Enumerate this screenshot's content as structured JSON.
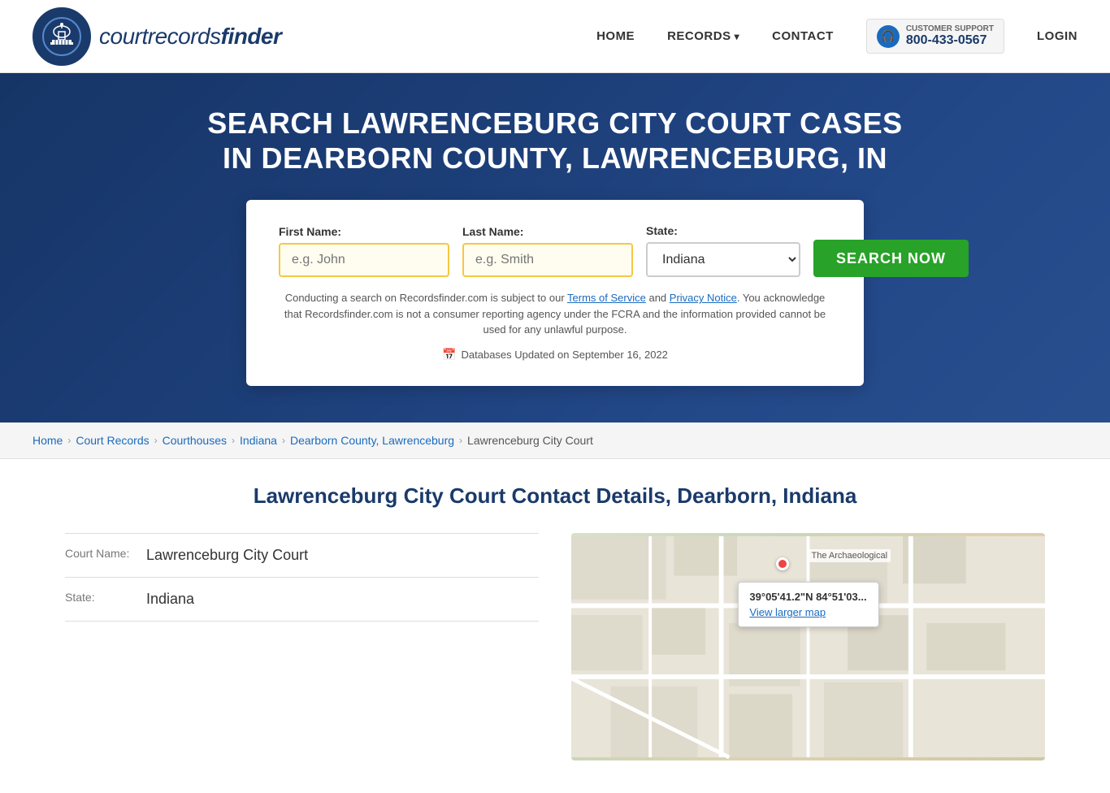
{
  "header": {
    "logo_text_italic": "courtrecords",
    "logo_text_bold": "finder",
    "nav": {
      "home": "HOME",
      "records": "RECORDS",
      "contact": "CONTACT",
      "login": "LOGIN"
    },
    "support": {
      "label": "CUSTOMER SUPPORT",
      "phone": "800-433-0567"
    }
  },
  "hero": {
    "title": "SEARCH LAWRENCEBURG CITY COURT CASES IN DEARBORN COUNTY, LAWRENCEBURG, IN",
    "search": {
      "first_name_label": "First Name:",
      "first_name_placeholder": "e.g. John",
      "last_name_label": "Last Name:",
      "last_name_placeholder": "e.g. Smith",
      "state_label": "State:",
      "state_value": "Indiana",
      "search_button": "SEARCH NOW"
    },
    "disclaimer": "Conducting a search on Recordsfinder.com is subject to our Terms of Service and Privacy Notice. You acknowledge that Recordsfinder.com is not a consumer reporting agency under the FCRA and the information provided cannot be used for any unlawful purpose.",
    "db_updated": "Databases Updated on September 16, 2022"
  },
  "breadcrumb": {
    "items": [
      {
        "label": "Home",
        "active": true
      },
      {
        "label": "Court Records",
        "active": true
      },
      {
        "label": "Courthouses",
        "active": true
      },
      {
        "label": "Indiana",
        "active": true
      },
      {
        "label": "Dearborn County, Lawrenceburg",
        "active": true
      },
      {
        "label": "Lawrenceburg City Court",
        "active": false
      }
    ]
  },
  "main": {
    "section_title": "Lawrenceburg City Court Contact Details, Dearborn, Indiana",
    "details": {
      "court_name_label": "Court Name:",
      "court_name_value": "Lawrenceburg City Court",
      "state_label": "State:",
      "state_value": "Indiana"
    },
    "map": {
      "coords": "39°05'41.2\"N 84°51'03...",
      "view_larger": "View larger map",
      "location_label": "The Archaeological"
    }
  }
}
